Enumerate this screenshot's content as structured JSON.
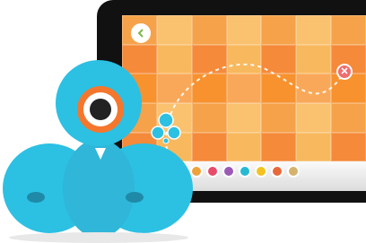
{
  "tablet": {
    "back_icon": "chevron-left-icon",
    "close_icon": "close-icon",
    "grid_colors": [
      "#f6a24a",
      "#f8b85d",
      "#f7922f",
      "#fac16f",
      "#f58a3a",
      "#f9a859"
    ],
    "accent": "#f06d6d",
    "tray_tools": [
      {
        "icon": "drive-icon",
        "color": "#f0a23a"
      },
      {
        "icon": "flag-icon",
        "color": "#e84b6a"
      },
      {
        "icon": "sound-icon",
        "color": "#9b59b6"
      },
      {
        "icon": "light-icon",
        "color": "#27b9d4"
      },
      {
        "icon": "star-icon",
        "color": "#f4c21f"
      },
      {
        "icon": "hand-icon",
        "color": "#e9683a"
      },
      {
        "icon": "box-icon",
        "color": "#d6b36d"
      }
    ]
  },
  "robot": {
    "body_color": "#2cc0e3",
    "eye_ring_color": "#f4772d",
    "eye_pupil_color": "#222222"
  }
}
